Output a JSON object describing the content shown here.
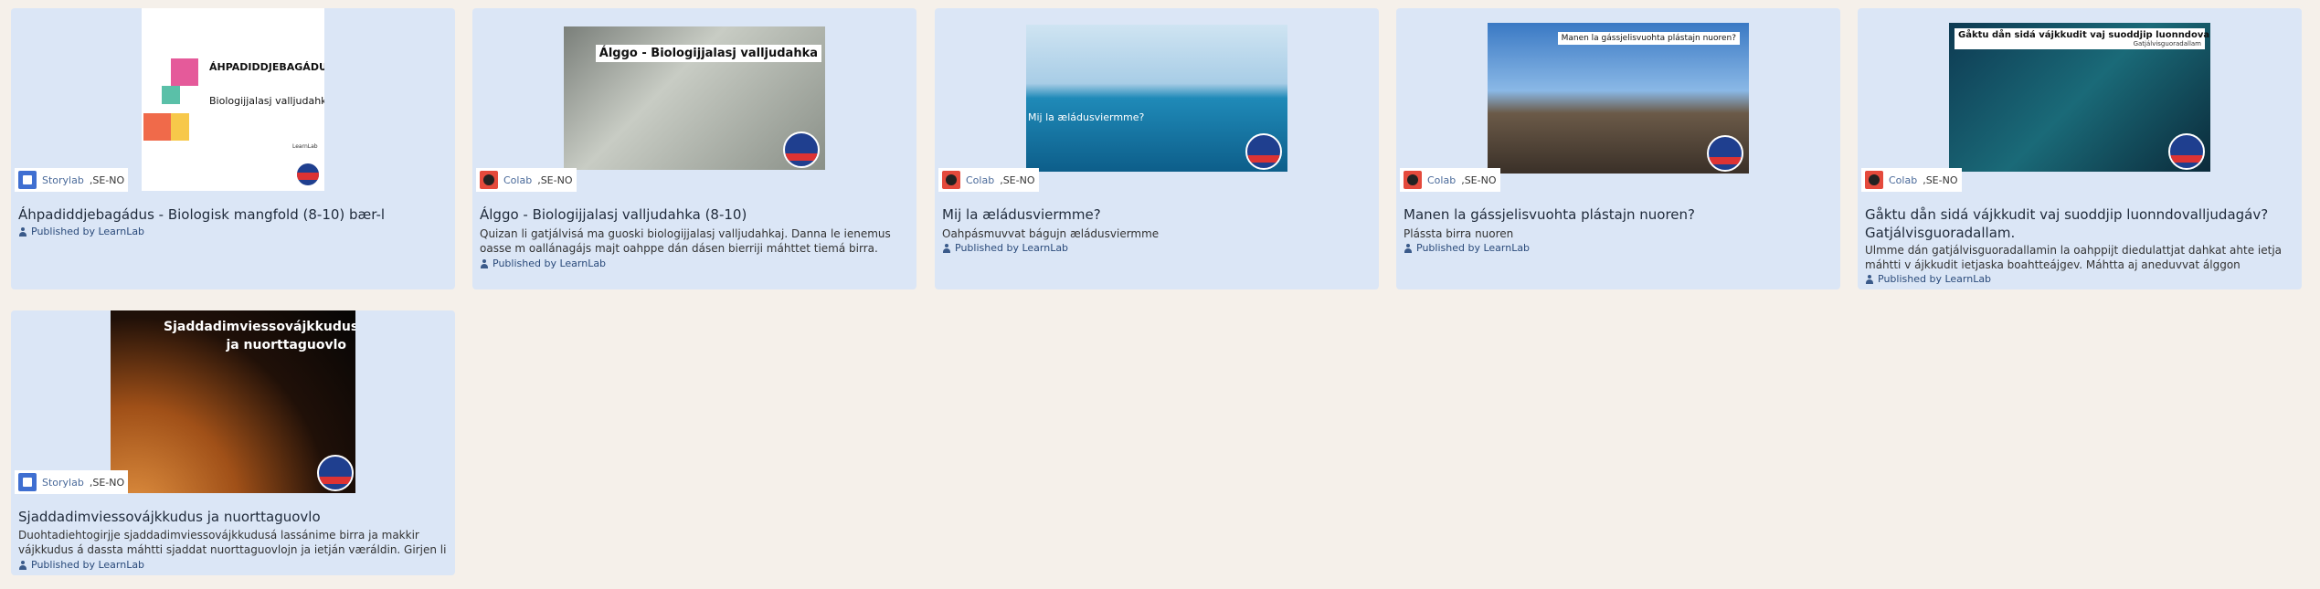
{
  "cards": [
    {
      "title": "Áhpadiddjebagádus - Biologisk mangfold (8-10) bær-l",
      "desc": "",
      "published": "Published by LearnLab",
      "platform": "Storylab",
      "lang": ",SE-NO",
      "thumb_heading": "ÁHPADIDDJEBAGÁDUS",
      "thumb_sub": "Biologijjalasj valljudahka",
      "thumb_logo": "LearnLab"
    },
    {
      "title": "Álggo - Biologijjalasj valljudahka (8-10)",
      "desc": "Quizan li gatjálvisá ma guoski biologijjalasj valljudahkaj. Danna le ienemus oasse m oallánagájs majt oahppe dán dásen bierriji máhttet tiemá birra. Moadda dájs gatjá…",
      "published": "Published by LearnLab",
      "platform": "Colab",
      "lang": ",SE-NO",
      "thumb_text": "Álggo - Biologijjalasj valljudahka"
    },
    {
      "title": "Mij la æládusviermme?",
      "desc": "Oahpásmuvvat bágujn æládusviermme",
      "published": "Published by LearnLab",
      "platform": "Colab",
      "lang": ",SE-NO",
      "thumb_text": "Mij la æládusviermme?"
    },
    {
      "title": "Manen la gássjelisvuohta plástajn nuoren?",
      "desc": "Plássta birra nuoren",
      "published": "Published by LearnLab",
      "platform": "Colab",
      "lang": ",SE-NO",
      "thumb_text": "Manen la gássjelisvuohta plástajn nuoren?"
    },
    {
      "title": "Gåktu dån sidá vájkkudit vaj suoddjip luonndovalljudagáv? Gatjálvisguoradallam.",
      "desc": "Ulmme dán gatjálvisguoradallamin la oahppijt diedulattjat dahkat ahte ietja máhtti v ájkkudit ietjaska boahtteájgev. Máhtta aj aneduvvat álggon tiebmábarggu jali tjál…",
      "published": "Published by LearnLab",
      "platform": "Colab",
      "lang": ",SE-NO",
      "thumb_text": "Gåktu dån sidá vájkkudit vaj suoddjip luonndovalljudagáv?",
      "thumb_sub": "Gatjálvisguoradallam"
    },
    {
      "title": "Sjaddadimviessovájkkudus ja nuorttaguovlo",
      "desc": "Duohtadiehtogirjje sjaddadimviessovájkkudusá lassánime birra ja makkir vájkkudus á dassta máhtti sjaddat nuorttaguovlojn ja ietján væráldin. Girjen li láhkåmusá, vid…",
      "published": "Published by LearnLab",
      "platform": "Storylab",
      "lang": ",SE-NO",
      "thumb_text": "Sjaddadimviessovájkkudus ja nuorttaguovlo"
    }
  ],
  "colors": {
    "card_bg": "#dbe6f6",
    "page_bg": "#f5f0ea",
    "storylab": "#3f6fd1",
    "colab": "#e44a3c"
  }
}
